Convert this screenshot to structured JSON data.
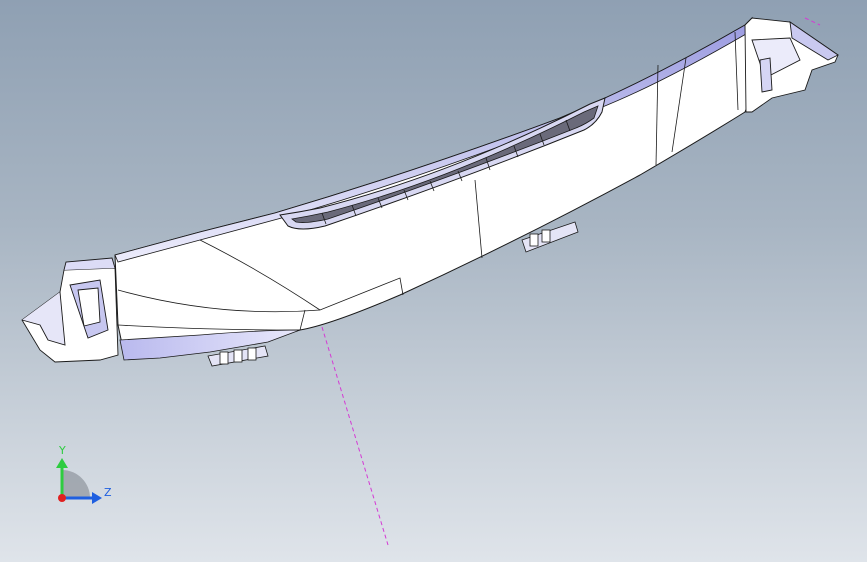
{
  "viewport": {
    "background_top": "#8fa0b3",
    "background_bottom": "#dfe4ea",
    "model_fill": "#ffffff",
    "model_shade": "#c9c9f0",
    "edge_color": "#1a1a1a",
    "center_axis_color": "#d43bd4"
  },
  "triad": {
    "y_label": "Y",
    "z_label": "Z",
    "x_color": "#e02020",
    "y_color": "#2ecc40",
    "z_color": "#1f5fe0"
  }
}
